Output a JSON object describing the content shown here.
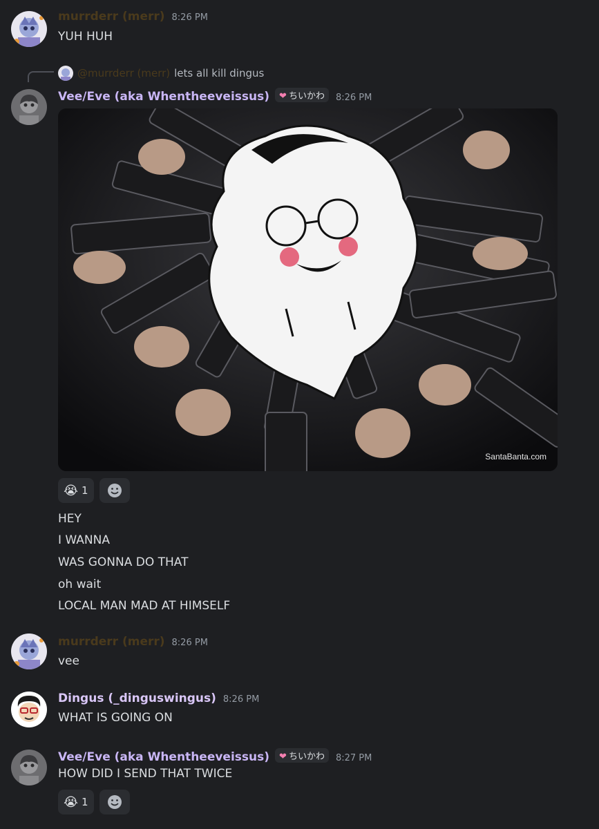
{
  "messages": [
    {
      "author": "murrderr (merr)",
      "time": "8:26 PM",
      "lines": [
        "YUH HUH"
      ]
    },
    {
      "reply_to": {
        "mention": "@murrderr (merr)",
        "text": "lets all kill dingus"
      },
      "author": "Vee/Eve (aka Whentheeveissus)",
      "tag": "ちいかわ",
      "time": "8:26 PM",
      "image_watermark": "SantaBanta.com",
      "reaction": {
        "emoji": "😭",
        "count": "1"
      },
      "lines": [
        "HEY",
        "I WANNA",
        "WAS GONNA DO THAT",
        "oh wait",
        "LOCAL MAN MAD AT HIMSELF"
      ]
    },
    {
      "author": "murrderr (merr)",
      "time": "8:26 PM",
      "lines": [
        "vee"
      ]
    },
    {
      "author": "Dingus (_dinguswingus)",
      "time": "8:26 PM",
      "lines": [
        "WHAT IS GOING ON"
      ]
    },
    {
      "author": "Vee/Eve (aka Whentheeveissus)",
      "tag": "ちいかわ",
      "time": "8:27 PM",
      "reaction": {
        "emoji": "😭",
        "count": "1"
      },
      "lines": [
        "HOW DID I SEND THAT TWICE"
      ]
    }
  ],
  "colors": {
    "background": "#1e1f22",
    "murrderr_name": "#4a3a1c",
    "vee_name": "#c9b6f5",
    "dingus_name": "#d9c6f7",
    "timestamp": "#949ba4",
    "text": "#dbdee1",
    "pill": "#2b2d31"
  },
  "icons": {
    "reaction_emoji": "loudly-crying-face",
    "add_reaction": "smiley-face-icon",
    "tag_icon": "heart-icon"
  }
}
